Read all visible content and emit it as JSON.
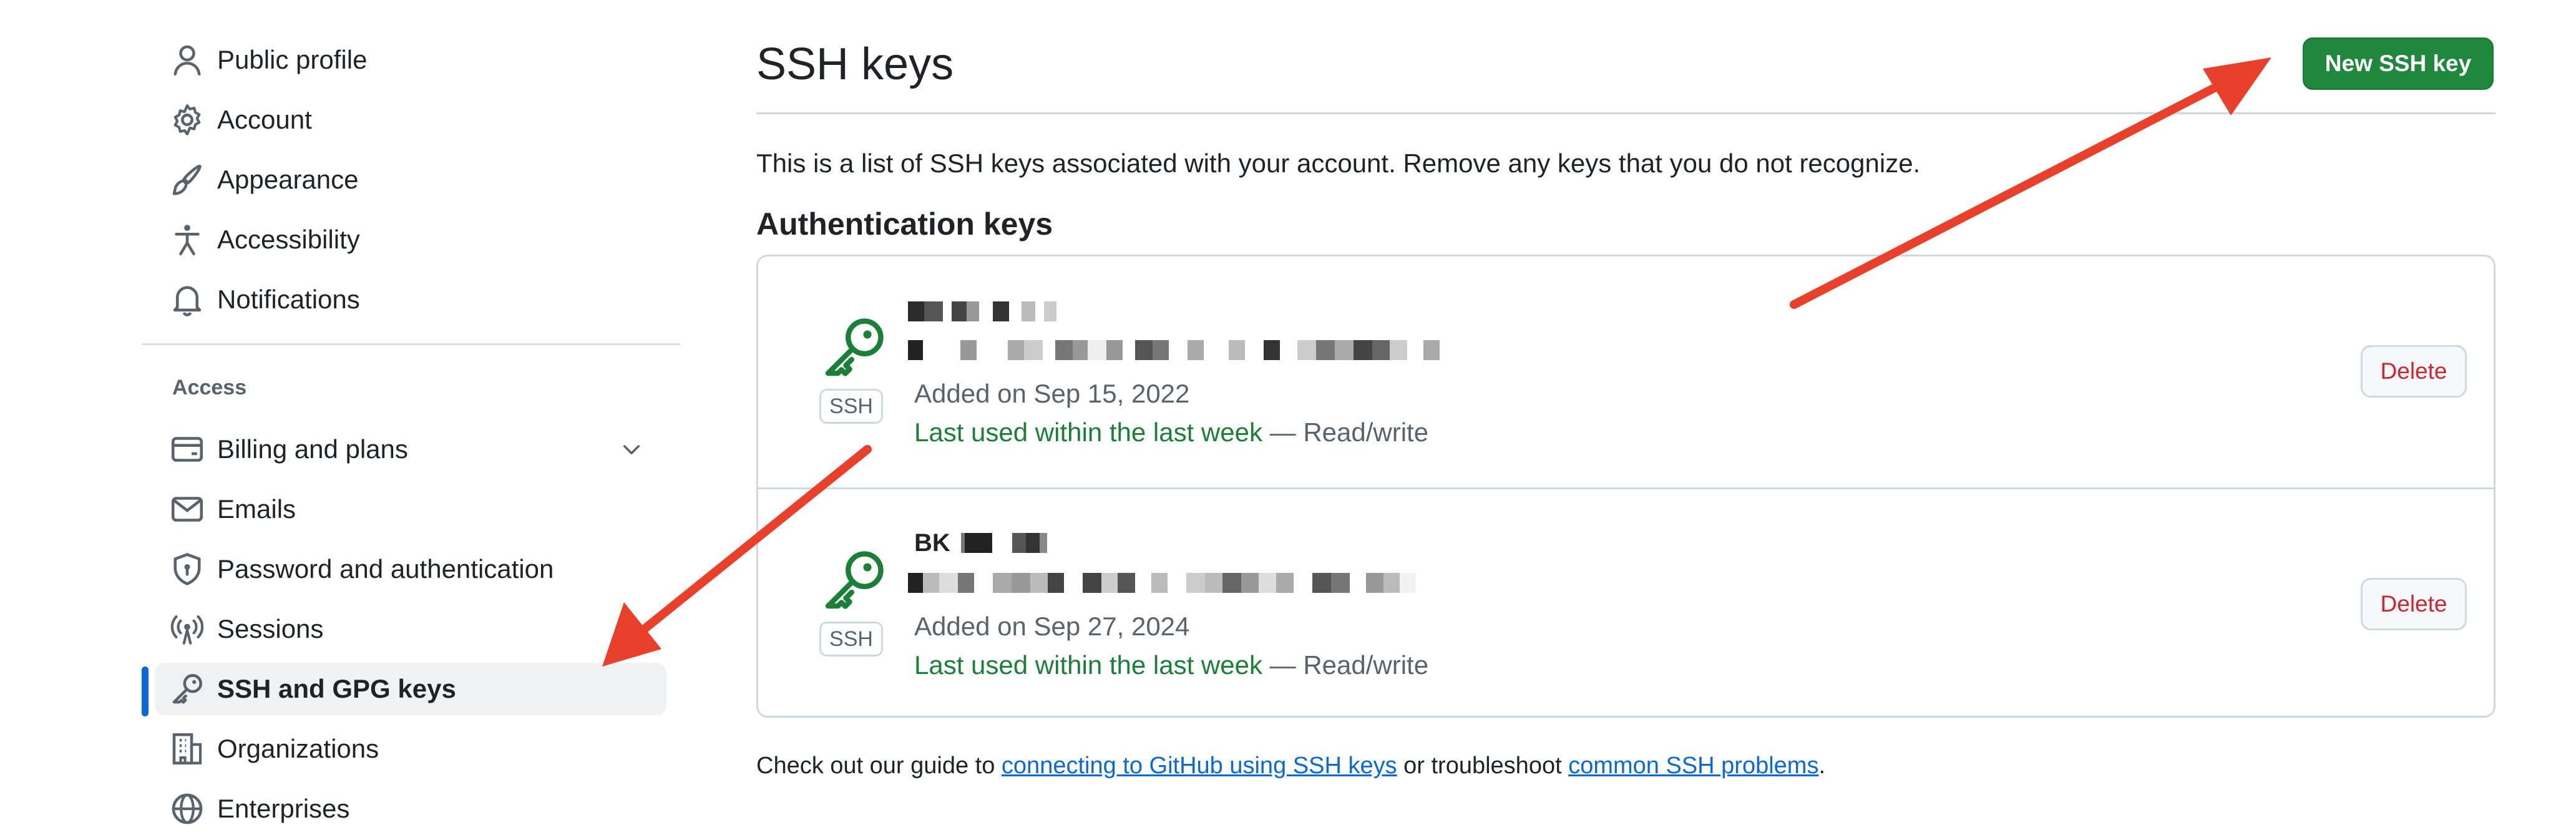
{
  "sidebar": {
    "items_top": [
      {
        "label": "Public profile",
        "icon": "person-icon"
      },
      {
        "label": "Account",
        "icon": "gear-icon"
      },
      {
        "label": "Appearance",
        "icon": "paintbrush-icon"
      },
      {
        "label": "Accessibility",
        "icon": "accessibility-icon"
      },
      {
        "label": "Notifications",
        "icon": "bell-icon"
      }
    ],
    "access_heading": "Access",
    "items_access": [
      {
        "label": "Billing and plans",
        "icon": "credit-card-icon"
      },
      {
        "label": "Emails",
        "icon": "mail-icon"
      },
      {
        "label": "Password and authentication",
        "icon": "shield-lock-icon"
      },
      {
        "label": "Sessions",
        "icon": "broadcast-icon"
      },
      {
        "label": "SSH and GPG keys",
        "icon": "key-icon",
        "active": true
      },
      {
        "label": "Organizations",
        "icon": "organization-icon"
      },
      {
        "label": "Enterprises",
        "icon": "globe-icon"
      }
    ]
  },
  "main": {
    "title": "SSH keys",
    "new_key_button": "New SSH key",
    "intro": "This is a list of SSH keys associated with your account. Remove any keys that you do not recognize.",
    "section_heading": "Authentication keys",
    "keys": [
      {
        "title": "",
        "badge": "SSH",
        "added": "Added on Sep 15, 2022",
        "last_used": "Last used within the last week",
        "access": " — Read/write",
        "delete": "Delete"
      },
      {
        "title": "BK",
        "badge": "SSH",
        "added": "Added on Sep 27, 2024",
        "last_used": "Last used within the last week",
        "access": " — Read/write",
        "delete": "Delete"
      }
    ],
    "footer": {
      "prefix": "Check out our guide to ",
      "link1": "connecting to GitHub using SSH keys",
      "middle": " or troubleshoot ",
      "link2": "common SSH problems",
      "suffix": "."
    }
  },
  "colors": {
    "accent_blue": "#0969da",
    "primary_green": "#1f883d",
    "danger_red": "#d1242f",
    "annotation_arrow": "#e8402b"
  }
}
